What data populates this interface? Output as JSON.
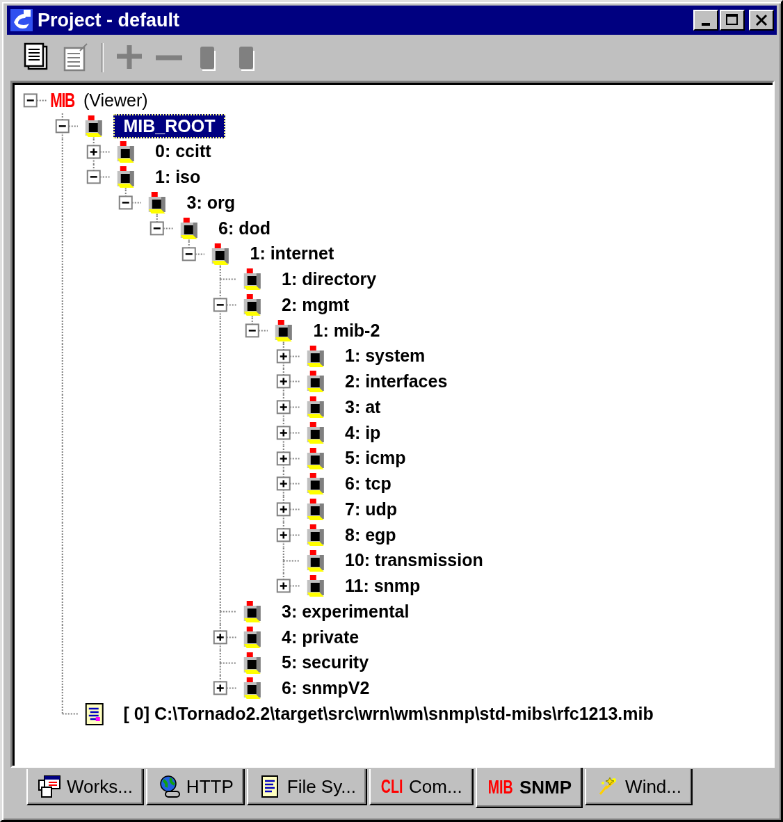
{
  "window": {
    "title": "Project - default"
  },
  "toolbar": [
    {
      "disabled": false
    },
    {
      "disabled": true
    },
    {
      "disabled": true
    },
    {
      "disabled": true
    },
    {
      "disabled": true
    },
    {
      "disabled": true
    }
  ],
  "tree": {
    "kind": "root",
    "logo": "MIB",
    "label": "(Viewer)",
    "expanded": true,
    "children": [
      {
        "kind": "object",
        "label": "MIB_ROOT",
        "expanded": true,
        "selected": true,
        "children": [
          {
            "kind": "object",
            "label": "0: ccitt",
            "expanded": false,
            "selected": false
          },
          {
            "kind": "object",
            "label": "1: iso",
            "expanded": true,
            "selected": false,
            "children": [
              {
                "kind": "object",
                "label": "3: org",
                "expanded": true,
                "selected": false,
                "children": [
                  {
                    "kind": "object",
                    "label": "6: dod",
                    "expanded": true,
                    "selected": false,
                    "children": [
                      {
                        "kind": "object",
                        "label": "1: internet",
                        "expanded": true,
                        "selected": false,
                        "children": [
                          {
                            "kind": "object",
                            "label": "1: directory",
                            "selected": false
                          },
                          {
                            "kind": "object",
                            "label": "2: mgmt",
                            "expanded": true,
                            "selected": false,
                            "children": [
                              {
                                "kind": "object",
                                "label": "1: mib-2",
                                "expanded": true,
                                "selected": false,
                                "children": [
                                  {
                                    "kind": "object",
                                    "label": "1: system",
                                    "expanded": false,
                                    "selected": false
                                  },
                                  {
                                    "kind": "object",
                                    "label": "2: interfaces",
                                    "expanded": false,
                                    "selected": false
                                  },
                                  {
                                    "kind": "object",
                                    "label": "3: at",
                                    "expanded": false,
                                    "selected": false
                                  },
                                  {
                                    "kind": "object",
                                    "label": "4: ip",
                                    "expanded": false,
                                    "selected": false
                                  },
                                  {
                                    "kind": "object",
                                    "label": "5: icmp",
                                    "expanded": false,
                                    "selected": false
                                  },
                                  {
                                    "kind": "object",
                                    "label": "6: tcp",
                                    "expanded": false,
                                    "selected": false
                                  },
                                  {
                                    "kind": "object",
                                    "label": "7: udp",
                                    "expanded": false,
                                    "selected": false
                                  },
                                  {
                                    "kind": "object",
                                    "label": "8: egp",
                                    "expanded": false,
                                    "selected": false
                                  },
                                  {
                                    "kind": "object",
                                    "label": "10: transmission",
                                    "selected": false
                                  },
                                  {
                                    "kind": "object",
                                    "label": "11: snmp",
                                    "expanded": false,
                                    "selected": false
                                  }
                                ]
                              }
                            ]
                          },
                          {
                            "kind": "object",
                            "label": "3: experimental",
                            "selected": false
                          },
                          {
                            "kind": "object",
                            "label": "4: private",
                            "expanded": false,
                            "selected": false
                          },
                          {
                            "kind": "object",
                            "label": "5: security",
                            "selected": false
                          },
                          {
                            "kind": "object",
                            "label": "6: snmpV2",
                            "expanded": false,
                            "selected": false
                          }
                        ]
                      }
                    ]
                  }
                ]
              }
            ]
          }
        ]
      },
      {
        "kind": "file",
        "label": "[ 0] C:\\Tornado2.2\\target\\src\\wrn\\wm\\snmp\\std-mibs\\rfc1213.mib",
        "selected": false
      }
    ]
  },
  "tabs": [
    {
      "label": "Works...",
      "selected": false
    },
    {
      "label": "HTTP",
      "selected": false
    },
    {
      "label": "File Sy...",
      "selected": false
    },
    {
      "logo": "CLI",
      "label": "Com...",
      "selected": false
    },
    {
      "logo": "MIB",
      "label": "SNMP",
      "selected": true
    },
    {
      "label": "Wind...",
      "selected": false
    }
  ]
}
